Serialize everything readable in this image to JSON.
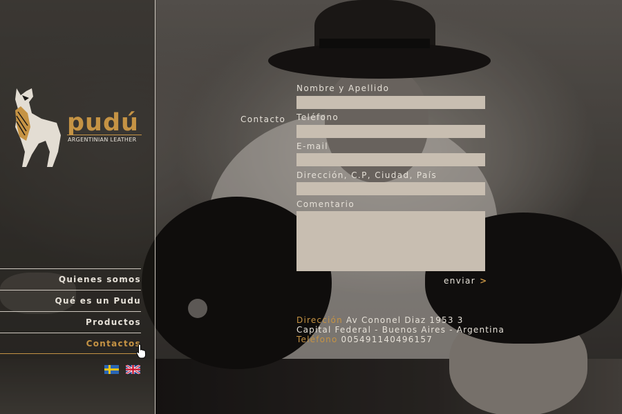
{
  "sidebar": {
    "brand": "pudú",
    "brand_sub": "ARGENTINIAN LEATHER",
    "nav": [
      {
        "label": "Quienes somos"
      },
      {
        "label": "Qué es un Pudu"
      },
      {
        "label": "Productos"
      },
      {
        "label": "Contactos"
      }
    ],
    "languages": [
      "sweden-flag-icon",
      "uk-flag-icon"
    ]
  },
  "form": {
    "section_label": "Contacto",
    "fields": [
      {
        "label": "Nombre y Apellido",
        "value": ""
      },
      {
        "label": "Teléfono",
        "value": ""
      },
      {
        "label": "E-mail",
        "value": ""
      },
      {
        "label": "Dirección, C.P, Ciudad, País",
        "value": ""
      },
      {
        "label": "Comentario",
        "value": ""
      }
    ],
    "submit_label": "enviar",
    "submit_arrow": ">"
  },
  "contact_info": {
    "address_label": "Dirección",
    "address_line1": "Av Cononel Diaz 1953 3",
    "address_line2": "Capital Federal - Buenos Aires - Argentina",
    "phone_label": "Teléfono",
    "phone": "005491140496157"
  },
  "colors": {
    "accent": "#c59344",
    "text": "#e6e1d8",
    "input_bg": "#c8beb1"
  }
}
